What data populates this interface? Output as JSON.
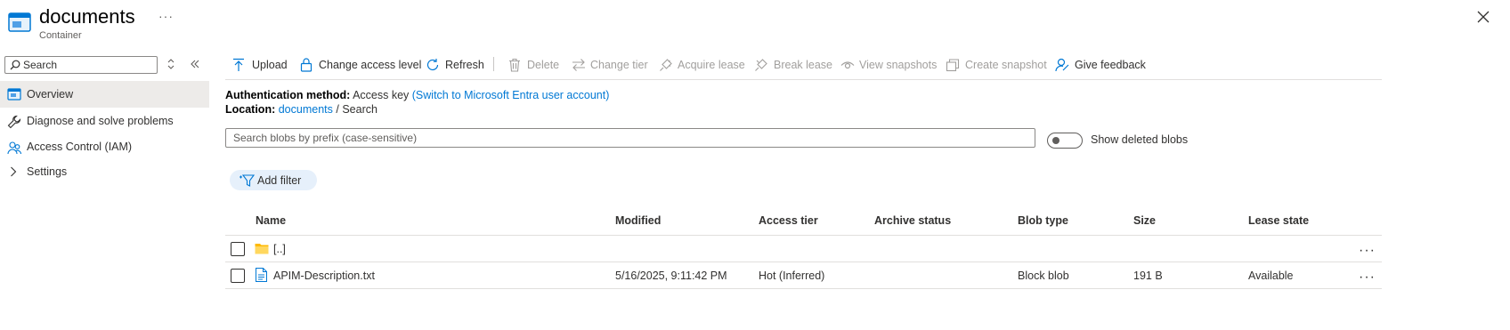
{
  "header": {
    "title": "documents",
    "subtitle": "Container",
    "more": "···",
    "icon": "container-icon"
  },
  "nav": {
    "search_placeholder": "Search",
    "items": [
      {
        "label": "Overview",
        "icon": "overview-icon",
        "selected": true
      },
      {
        "label": "Diagnose and solve problems",
        "icon": "wrench-icon"
      },
      {
        "label": "Access Control (IAM)",
        "icon": "people-icon"
      },
      {
        "label": "Settings",
        "icon": "chevron-right-icon"
      }
    ]
  },
  "toolbar": {
    "upload": "Upload",
    "change_access_level": "Change access level",
    "refresh": "Refresh",
    "delete": "Delete",
    "change_tier": "Change tier",
    "acquire_lease": "Acquire lease",
    "break_lease": "Break lease",
    "view_snapshots": "View snapshots",
    "create_snapshot": "Create snapshot",
    "give_feedback": "Give feedback"
  },
  "info": {
    "auth_label": "Authentication method:",
    "auth_value": "Access key",
    "auth_link": "(Switch to Microsoft Entra user account)",
    "location_label": "Location:",
    "location_link": "documents",
    "location_sep": "/",
    "location_current": "Search"
  },
  "blob_search": {
    "placeholder": "Search blobs by prefix (case-sensitive)"
  },
  "show_deleted": {
    "label": "Show deleted blobs",
    "on": false
  },
  "filter": {
    "add_label": "Add filter"
  },
  "table": {
    "columns": [
      "Name",
      "Modified",
      "Access tier",
      "Archive status",
      "Blob type",
      "Size",
      "Lease state"
    ],
    "rows": [
      {
        "name": "[..]",
        "type": "folder",
        "modified": "",
        "access_tier": "",
        "archive_status": "",
        "blob_type": "",
        "size": "",
        "lease_state": "",
        "more": "···"
      },
      {
        "name": "APIM-Description.txt",
        "type": "file",
        "modified": "5/16/2025, 9:11:42 PM",
        "access_tier": "Hot (Inferred)",
        "archive_status": "",
        "blob_type": "Block blob",
        "size": "191 B",
        "lease_state": "Available",
        "more": "···"
      }
    ]
  },
  "colors": {
    "accent": "#0078d4",
    "disabled": "#a19f9d",
    "selected_bg": "#edebe9",
    "folder": "#ffb900"
  }
}
